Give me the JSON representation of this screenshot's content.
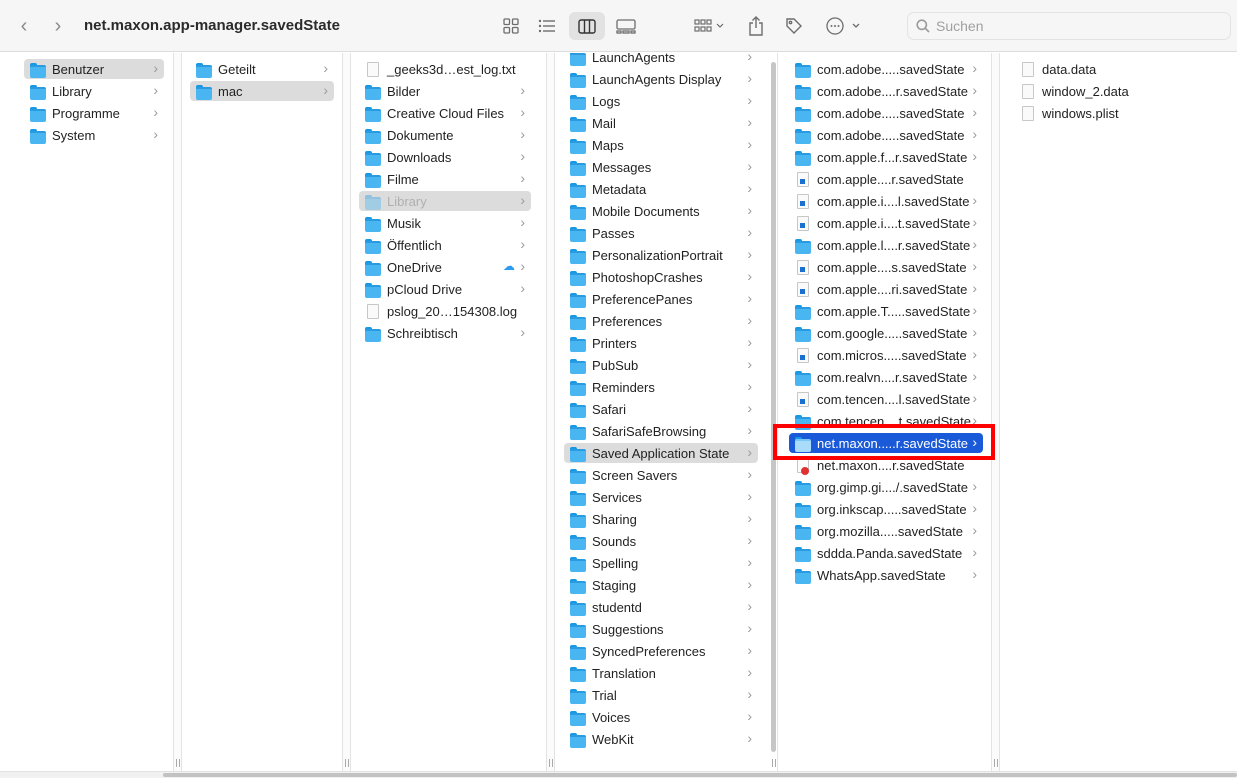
{
  "window": {
    "title": "net.maxon.app-manager.savedState"
  },
  "toolbar": {
    "back_glyph": "‹",
    "forward_glyph": "›",
    "icons": [
      "grid-view-icon",
      "list-view-icon",
      "column-view-icon",
      "gallery-view-icon",
      "group-icon",
      "share-icon",
      "tag-icon",
      "more-icon"
    ],
    "search_placeholder": "Suchen"
  },
  "columns": [
    {
      "items": [
        {
          "label": "Benutzer",
          "icon": "folder",
          "chevron": true,
          "selected": "gray"
        },
        {
          "label": "Library",
          "icon": "folder",
          "chevron": true
        },
        {
          "label": "Programme",
          "icon": "folder",
          "chevron": true
        },
        {
          "label": "System",
          "icon": "folder",
          "chevron": true
        }
      ]
    },
    {
      "items": [
        {
          "label": "Geteilt",
          "icon": "folder",
          "chevron": true
        },
        {
          "label": "mac",
          "icon": "folder",
          "chevron": true,
          "selected": "gray"
        }
      ]
    },
    {
      "items": [
        {
          "label": "_geeks3d…est_log.txt",
          "icon": "doc"
        },
        {
          "label": "Bilder",
          "icon": "folder",
          "chevron": true
        },
        {
          "label": "Creative Cloud Files",
          "icon": "folder",
          "chevron": true
        },
        {
          "label": "Dokumente",
          "icon": "folder",
          "chevron": true
        },
        {
          "label": "Downloads",
          "icon": "folder",
          "chevron": true
        },
        {
          "label": "Filme",
          "icon": "folder",
          "chevron": true
        },
        {
          "label": "Library",
          "icon": "folder",
          "chevron": true,
          "selected": "gray",
          "dim": true
        },
        {
          "label": "Musik",
          "icon": "folder",
          "chevron": true
        },
        {
          "label": "Öffentlich",
          "icon": "folder",
          "chevron": true
        },
        {
          "label": "OneDrive",
          "icon": "folder",
          "chevron": true,
          "cloud": true
        },
        {
          "label": "pCloud Drive",
          "icon": "folder",
          "chevron": true
        },
        {
          "label": "pslog_20…154308.log",
          "icon": "doc"
        },
        {
          "label": "Schreibtisch",
          "icon": "folder",
          "chevron": true
        }
      ]
    },
    {
      "items": [
        {
          "label": "LaunchAgents",
          "icon": "folder",
          "chevron": true
        },
        {
          "label": "LaunchAgents Display",
          "icon": "folder",
          "chevron": true
        },
        {
          "label": "Logs",
          "icon": "folder",
          "chevron": true
        },
        {
          "label": "Mail",
          "icon": "folder",
          "chevron": true
        },
        {
          "label": "Maps",
          "icon": "folder",
          "chevron": true
        },
        {
          "label": "Messages",
          "icon": "folder",
          "chevron": true
        },
        {
          "label": "Metadata",
          "icon": "folder",
          "chevron": true
        },
        {
          "label": "Mobile Documents",
          "icon": "folder",
          "chevron": true
        },
        {
          "label": "Passes",
          "icon": "folder",
          "chevron": true
        },
        {
          "label": "PersonalizationPortrait",
          "icon": "folder",
          "chevron": true
        },
        {
          "label": "PhotoshopCrashes",
          "icon": "folder",
          "chevron": true
        },
        {
          "label": "PreferencePanes",
          "icon": "folder",
          "chevron": true
        },
        {
          "label": "Preferences",
          "icon": "folder",
          "chevron": true
        },
        {
          "label": "Printers",
          "icon": "folder",
          "chevron": true
        },
        {
          "label": "PubSub",
          "icon": "folder",
          "chevron": true
        },
        {
          "label": "Reminders",
          "icon": "folder",
          "chevron": true
        },
        {
          "label": "Safari",
          "icon": "folder",
          "chevron": true
        },
        {
          "label": "SafariSafeBrowsing",
          "icon": "folder",
          "chevron": true
        },
        {
          "label": "Saved Application State",
          "icon": "folder",
          "chevron": true,
          "selected": "gray"
        },
        {
          "label": "Screen Savers",
          "icon": "folder",
          "chevron": true
        },
        {
          "label": "Services",
          "icon": "folder",
          "chevron": true
        },
        {
          "label": "Sharing",
          "icon": "folder",
          "chevron": true
        },
        {
          "label": "Sounds",
          "icon": "folder",
          "chevron": true
        },
        {
          "label": "Spelling",
          "icon": "folder",
          "chevron": true
        },
        {
          "label": "Staging",
          "icon": "folder",
          "chevron": true
        },
        {
          "label": "studentd",
          "icon": "folder",
          "chevron": true
        },
        {
          "label": "Suggestions",
          "icon": "folder",
          "chevron": true
        },
        {
          "label": "SyncedPreferences",
          "icon": "folder",
          "chevron": true
        },
        {
          "label": "Translation",
          "icon": "folder",
          "chevron": true
        },
        {
          "label": "Trial",
          "icon": "folder",
          "chevron": true
        },
        {
          "label": "Voices",
          "icon": "folder",
          "chevron": true
        },
        {
          "label": "WebKit",
          "icon": "folder",
          "chevron": true
        }
      ]
    },
    {
      "items": [
        {
          "label": "com.adobe.....savedState",
          "icon": "folder",
          "chevron": true
        },
        {
          "label": "com.adobe....r.savedState",
          "icon": "folder",
          "chevron": true
        },
        {
          "label": "com.adobe.....savedState",
          "icon": "folder",
          "chevron": true
        },
        {
          "label": "com.adobe.....savedState",
          "icon": "folder",
          "chevron": true
        },
        {
          "label": "com.apple.f...r.savedState",
          "icon": "folder",
          "chevron": true
        },
        {
          "label": "com.apple....r.savedState",
          "icon": "doc-exec"
        },
        {
          "label": "com.apple.i....l.savedState",
          "icon": "doc-exec",
          "chevron": true
        },
        {
          "label": "com.apple.i....t.savedState",
          "icon": "doc-exec",
          "chevron": true
        },
        {
          "label": "com.apple.l....r.savedState",
          "icon": "folder",
          "chevron": true
        },
        {
          "label": "com.apple....s.savedState",
          "icon": "doc-exec",
          "chevron": true
        },
        {
          "label": "com.apple....ri.savedState",
          "icon": "doc-exec",
          "chevron": true
        },
        {
          "label": "com.apple.T.....savedState",
          "icon": "folder",
          "chevron": true
        },
        {
          "label": "com.google.....savedState",
          "icon": "folder",
          "chevron": true
        },
        {
          "label": "com.micros.....savedState",
          "icon": "doc-exec",
          "chevron": true
        },
        {
          "label": "com.realvn....r.savedState",
          "icon": "folder",
          "chevron": true
        },
        {
          "label": "com.tencen....l.savedState",
          "icon": "doc-exec",
          "chevron": true
        },
        {
          "label": "com.tencen....t.savedState",
          "icon": "folder",
          "chevron": true
        },
        {
          "label": "net.maxon.....r.savedState",
          "icon": "folder",
          "chevron": true,
          "selected": "blue"
        },
        {
          "label": "net.maxon....r.savedState",
          "icon": "doc-nogo"
        },
        {
          "label": "org.gimp.gi..../.savedState",
          "icon": "folder",
          "chevron": true
        },
        {
          "label": "org.inkscap.....savedState",
          "icon": "folder",
          "chevron": true
        },
        {
          "label": "org.mozilla.....savedState",
          "icon": "folder",
          "chevron": true
        },
        {
          "label": "sddda.Panda.savedState",
          "icon": "folder",
          "chevron": true
        },
        {
          "label": "WhatsApp.savedState",
          "icon": "folder",
          "chevron": true
        }
      ]
    },
    {
      "items": [
        {
          "label": "data.data",
          "icon": "doc"
        },
        {
          "label": "window_2.data",
          "icon": "doc"
        },
        {
          "label": "windows.plist",
          "icon": "doc"
        }
      ]
    }
  ],
  "colors": {
    "selection_blue": "#1a5ad9",
    "selection_gray": "#dcdcdc",
    "folder_blue": "#49b6f2",
    "highlight_red": "#ff0000"
  }
}
